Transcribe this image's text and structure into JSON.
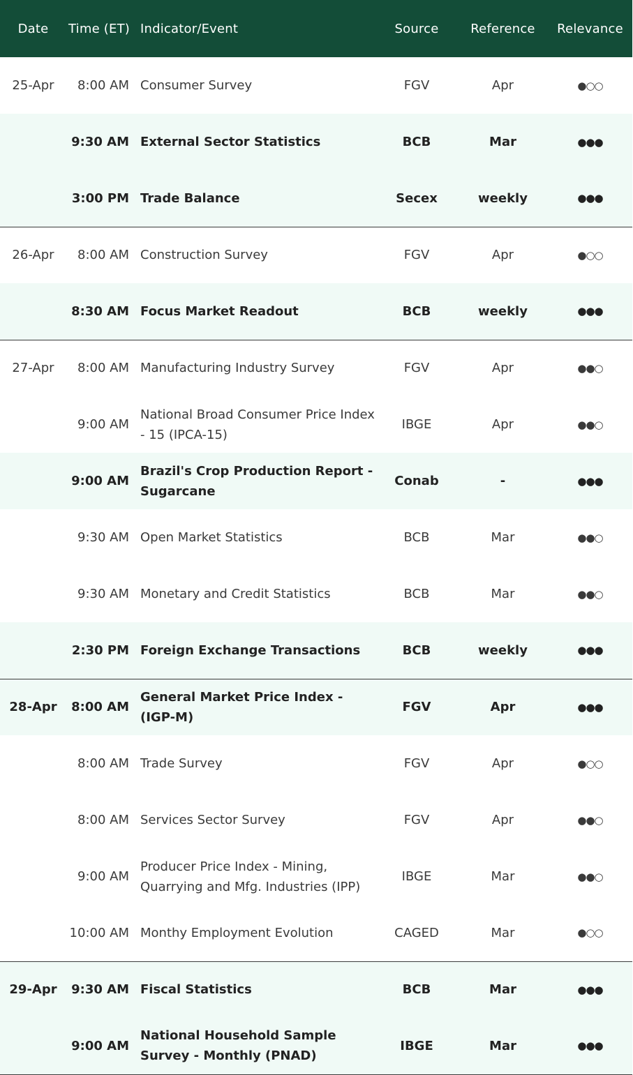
{
  "header": {
    "date": "Date",
    "time": "Time (ET)",
    "indicator": "Indicator/Event",
    "source": "Source",
    "reference": "Reference",
    "relevance": "Relevance"
  },
  "rows": [
    {
      "date": "25-Apr",
      "time": "8:00 AM",
      "indicator": "Consumer Survey",
      "source": "FGV",
      "reference": "Apr",
      "relevance": "●○○",
      "highlight": false,
      "sep": false
    },
    {
      "date": "",
      "time": "9:30 AM",
      "indicator": "External Sector Statistics",
      "source": "BCB",
      "reference": "Mar",
      "relevance": "●●●",
      "highlight": true,
      "sep": false
    },
    {
      "date": "",
      "time": "3:00 PM",
      "indicator": "Trade Balance",
      "source": "Secex",
      "reference": "weekly",
      "relevance": "●●●",
      "highlight": true,
      "sep": false
    },
    {
      "date": "26-Apr",
      "time": "8:00 AM",
      "indicator": "Construction Survey",
      "source": "FGV",
      "reference": "Apr",
      "relevance": "●○○",
      "highlight": false,
      "sep": true
    },
    {
      "date": "",
      "time": "8:30 AM",
      "indicator": "Focus Market Readout",
      "source": "BCB",
      "reference": "weekly",
      "relevance": "●●●",
      "highlight": true,
      "sep": false
    },
    {
      "date": "27-Apr",
      "time": "8:00 AM",
      "indicator": "Manufacturing Industry Survey",
      "source": "FGV",
      "reference": "Apr",
      "relevance": "●●○",
      "highlight": false,
      "sep": true
    },
    {
      "date": "",
      "time": "9:00 AM",
      "indicator": "National Broad Consumer Price Index - 15 (IPCA-15)",
      "source": "IBGE",
      "reference": "Apr",
      "relevance": "●●○",
      "highlight": false,
      "sep": false
    },
    {
      "date": "",
      "time": "9:00 AM",
      "indicator": "Brazil's Crop Production Report - Sugarcane",
      "source": "Conab",
      "reference": "-",
      "relevance": "●●●",
      "highlight": true,
      "sep": false
    },
    {
      "date": "",
      "time": "9:30 AM",
      "indicator": "Open Market Statistics",
      "source": "BCB",
      "reference": "Mar",
      "relevance": "●●○",
      "highlight": false,
      "sep": false
    },
    {
      "date": "",
      "time": "9:30 AM",
      "indicator": "Monetary and Credit Statistics",
      "source": "BCB",
      "reference": "Mar",
      "relevance": "●●○",
      "highlight": false,
      "sep": false
    },
    {
      "date": "",
      "time": "2:30 PM",
      "indicator": "Foreign Exchange Transactions",
      "source": "BCB",
      "reference": "weekly",
      "relevance": "●●●",
      "highlight": true,
      "sep": false
    },
    {
      "date": "28-Apr",
      "time": "8:00 AM",
      "indicator": "General Market Price Index - (IGP-M)",
      "source": "FGV",
      "reference": "Apr",
      "relevance": "●●●",
      "highlight": true,
      "sep": true
    },
    {
      "date": "",
      "time": "8:00 AM",
      "indicator": "Trade Survey",
      "source": "FGV",
      "reference": "Apr",
      "relevance": "●○○",
      "highlight": false,
      "sep": false
    },
    {
      "date": "",
      "time": "8:00 AM",
      "indicator": "Services Sector Survey",
      "source": "FGV",
      "reference": "Apr",
      "relevance": "●●○",
      "highlight": false,
      "sep": false
    },
    {
      "date": "",
      "time": "9:00 AM",
      "indicator": "Producer Price Index - Mining, Quarrying and Mfg. Industries (IPP)",
      "source": "IBGE",
      "reference": "Mar",
      "relevance": "●●○",
      "highlight": false,
      "sep": false
    },
    {
      "date": "",
      "time": "10:00 AM",
      "indicator": "Monthy Employment Evolution",
      "source": "CAGED",
      "reference": "Mar",
      "relevance": "●○○",
      "highlight": false,
      "sep": false
    },
    {
      "date": "29-Apr",
      "time": "9:30 AM",
      "indicator": "Fiscal Statistics",
      "source": "BCB",
      "reference": "Mar",
      "relevance": "●●●",
      "highlight": true,
      "sep": true
    },
    {
      "date": "",
      "time": "9:00 AM",
      "indicator": "National Household Sample Survey - Monthly (PNAD)",
      "source": "IBGE",
      "reference": "Mar",
      "relevance": "●●●",
      "highlight": true,
      "sep": false
    }
  ]
}
